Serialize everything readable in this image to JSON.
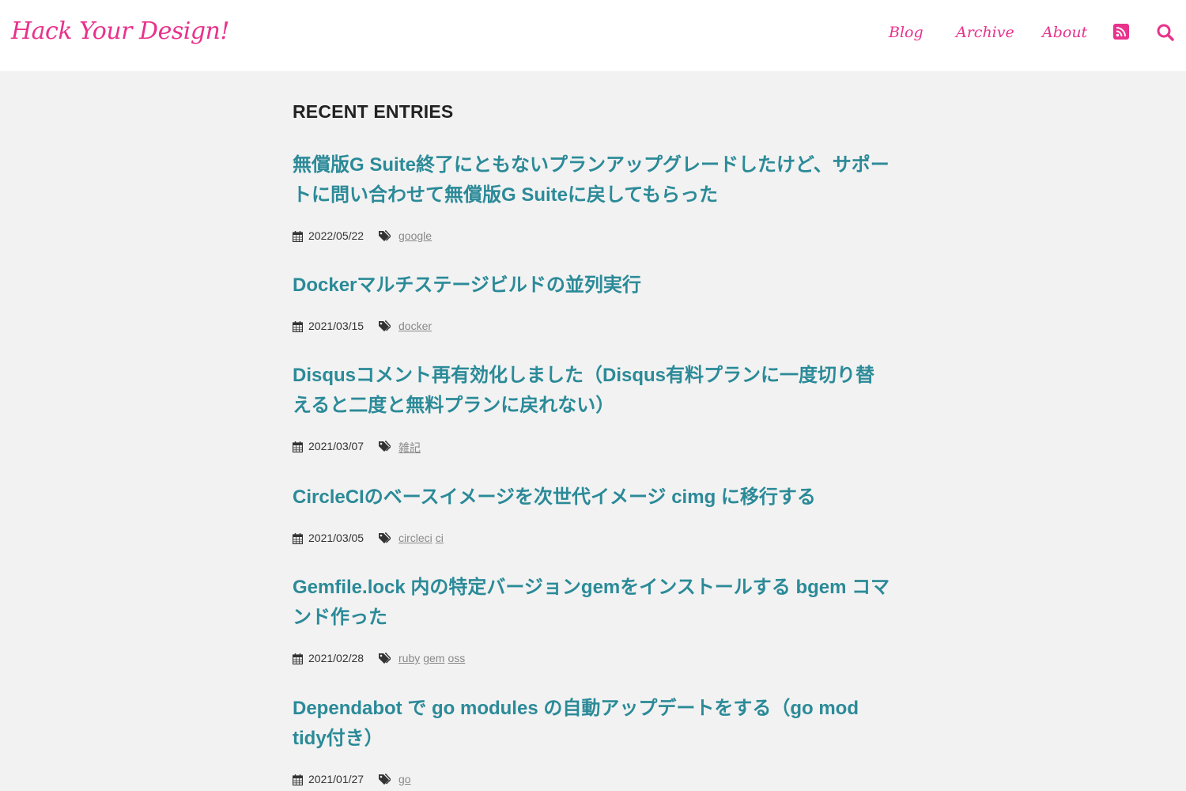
{
  "header": {
    "brand": "Hack Your Design!",
    "nav": {
      "blog": "Blog",
      "archive": "Archive",
      "about": "About"
    },
    "icons": {
      "rss": "rss-icon",
      "search": "search-icon"
    },
    "accent_color": "#e8328c"
  },
  "main": {
    "section_title": "RECENT ENTRIES",
    "title_color": "#2b8a98",
    "entries": [
      {
        "title": "無償版G Suite終了にともないプランアップグレードしたけど、サポートに問い合わせて無償版G Suiteに戻してもらった",
        "date": "2022/05/22",
        "tags": [
          "google"
        ]
      },
      {
        "title": "Dockerマルチステージビルドの並列実行",
        "date": "2021/03/15",
        "tags": [
          "docker"
        ]
      },
      {
        "title": "Disqusコメント再有効化しました（Disqus有料プランに一度切り替えると二度と無料プランに戻れない）",
        "date": "2021/03/07",
        "tags": [
          "雑記"
        ]
      },
      {
        "title": "CircleCIのベースイメージを次世代イメージ cimg に移行する",
        "date": "2021/03/05",
        "tags": [
          "circleci",
          "ci"
        ]
      },
      {
        "title": "Gemfile.lock 内の特定バージョンgemをインストールする bgem コマンド作った",
        "date": "2021/02/28",
        "tags": [
          "ruby",
          "gem",
          "oss"
        ]
      },
      {
        "title": "Dependabot で go modules の自動アップデートをする（go mod tidy付き）",
        "date": "2021/01/27",
        "tags": [
          "go"
        ]
      }
    ]
  }
}
